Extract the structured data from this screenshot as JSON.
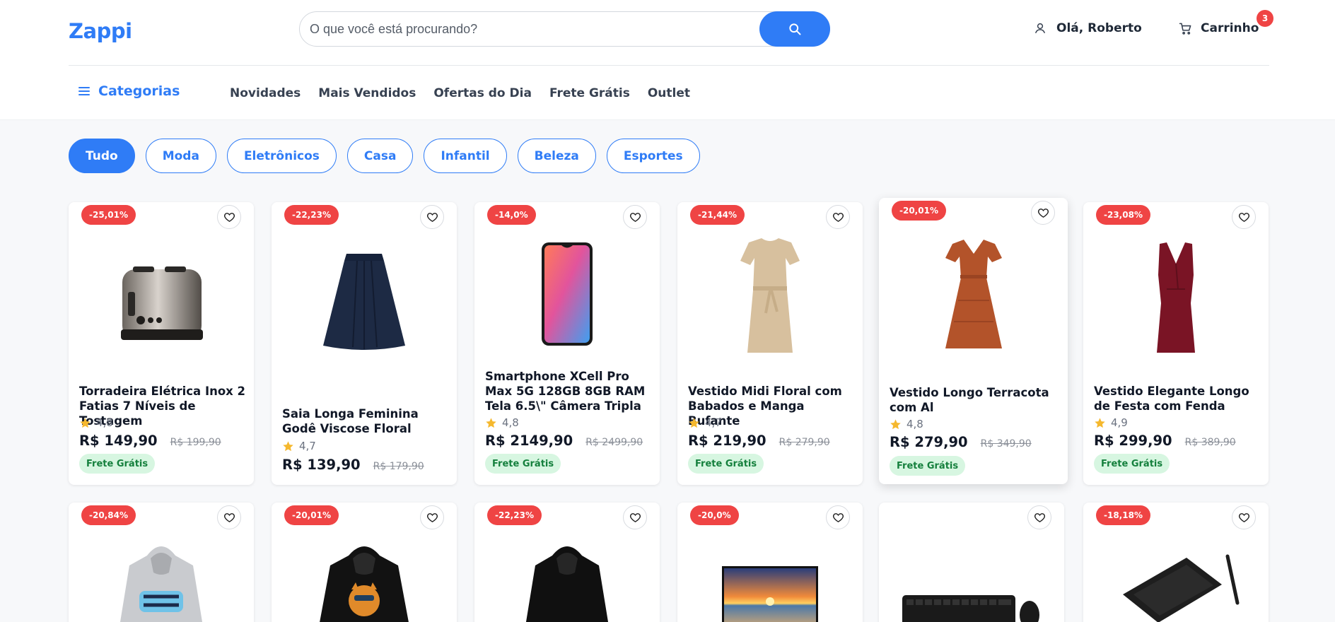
{
  "header": {
    "logo": "Zappi",
    "search_placeholder": "O que você está procurando?",
    "user_greeting": "Olá, Roberto",
    "cart_label": "Carrinho",
    "cart_count": "3",
    "categories_label": "Categorias",
    "nav": [
      "Novidades",
      "Mais Vendidos",
      "Ofertas do Dia",
      "Frete Grátis",
      "Outlet"
    ]
  },
  "chips": [
    "Tudo",
    "Moda",
    "Eletrônicos",
    "Casa",
    "Infantil",
    "Beleza",
    "Esportes"
  ],
  "active_chip": "Tudo",
  "free_shipping_label": "Frete Grátis",
  "products": [
    {
      "discount": "-25,01%",
      "title": "Torradeira Elétrica Inox 2 Fatias 7 Níveis de Tostagem",
      "rating": "4,8",
      "price": "R$ 149,90",
      "old_price": "R$ 199,90",
      "image": "toaster",
      "free_shipping": true
    },
    {
      "discount": "-22,23%",
      "title": "Saia Longa Feminina Godê Viscose Floral",
      "rating": "4,7",
      "price": "R$ 139,90",
      "old_price": "R$ 179,90",
      "image": "navy-skirt",
      "free_shipping": false
    },
    {
      "discount": "-14,0%",
      "title": "Smartphone XCell Pro Max 5G 128GB 8GB RAM Tela 6.5\\\" Câmera Tripla",
      "rating": "4,8",
      "price": "R$ 2149,90",
      "old_price": "R$ 2499,90",
      "image": "smartphone",
      "free_shipping": true
    },
    {
      "discount": "-21,44%",
      "title": "Vestido Midi Floral com Babados e Manga Bufante",
      "rating": "4,7",
      "price": "R$ 219,90",
      "old_price": "R$ 279,90",
      "image": "beige-dress",
      "free_shipping": true
    },
    {
      "discount": "-20,01%",
      "title": "Vestido Longo Terracota com Al",
      "rating": "4,8",
      "price": "R$ 279,90",
      "old_price": "R$ 349,90",
      "image": "terracotta-dress",
      "free_shipping": true
    },
    {
      "discount": "-23,08%",
      "title": "Vestido Elegante Longo de Festa com Fenda",
      "rating": "4,9",
      "price": "R$ 299,90",
      "old_price": "R$ 389,90",
      "image": "burgundy-dress",
      "free_shipping": true
    },
    {
      "discount": "-20,84%",
      "image": "grey-hoodie"
    },
    {
      "discount": "-20,01%",
      "image": "black-hoodie-cat"
    },
    {
      "discount": "-22,23%",
      "image": "black-hoodie"
    },
    {
      "discount": "-20,0%",
      "image": "television"
    },
    {
      "discount": "",
      "image": "keyboard-mouse"
    },
    {
      "discount": "-18,18%",
      "image": "drawing-tablet"
    }
  ],
  "colors": {
    "accent": "#2f7cf6",
    "discount": "#ef4444",
    "free_bg": "#d7f6e1",
    "free_text": "#15803d"
  }
}
